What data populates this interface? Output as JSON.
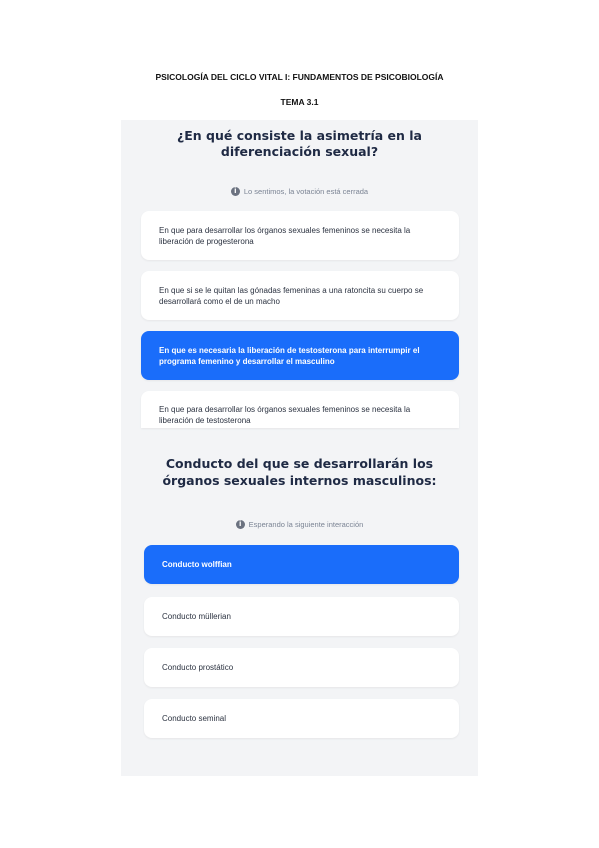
{
  "document": {
    "title": "PSICOLOGÍA DEL CICLO VITAL I: FUNDAMENTOS DE PSICOBIOLOGÍA",
    "topic": "TEMA 3.1"
  },
  "question1": {
    "text": "¿En qué consiste la asimetría en la diferenciación sexual?",
    "status": "Lo sentimos, la votación está cerrada",
    "options": [
      "En que para desarrollar los órganos sexuales femeninos se necesita la liberación de progesterona",
      "En que si se le quitan las gónadas femeninas a una ratoncita su cuerpo se desarrollará como el de un macho",
      "En que es necesaria la liberación de testosterona para interrumpir el programa femenino y desarrollar el masculino",
      "En que para desarrollar los órganos sexuales femeninos se necesita la liberación de testosterona"
    ]
  },
  "question2": {
    "text": "Conducto del que se desarrollarán los órganos sexuales internos masculinos:",
    "status": "Esperando la siguiente interacción",
    "options": [
      "Conducto wolffian",
      "Conducto müllerian",
      "Conducto prostático",
      "Conducto seminal"
    ]
  },
  "colors": {
    "accent": "#1a6dfa",
    "panel": "#f3f4f6"
  },
  "icons": {
    "status": "info-icon"
  }
}
